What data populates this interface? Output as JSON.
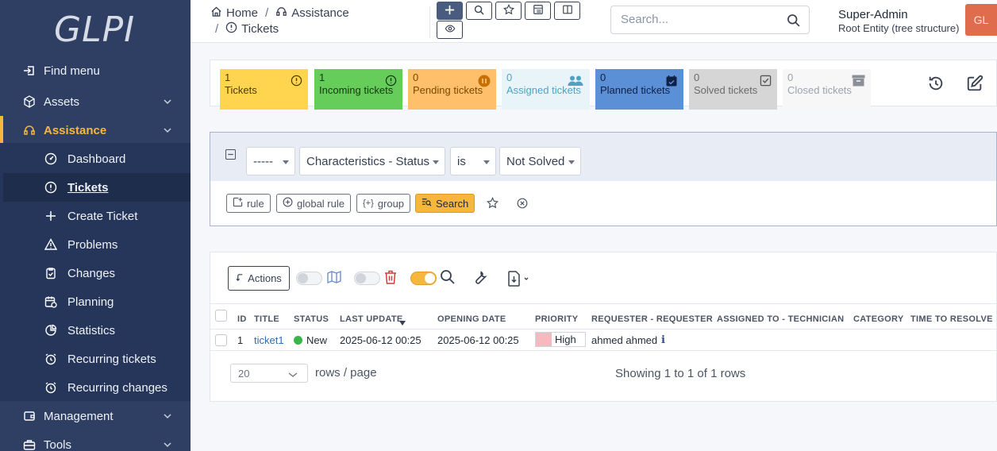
{
  "app": {
    "logo": "GLPI"
  },
  "sidebar": {
    "items": [
      {
        "label": "Find menu",
        "icon": "find-menu-icon"
      },
      {
        "label": "Assets",
        "icon": "cube-icon"
      },
      {
        "label": "Assistance",
        "icon": "headset-icon"
      },
      {
        "label": "Management",
        "icon": "wallet-icon"
      },
      {
        "label": "Tools",
        "icon": "briefcase-icon"
      }
    ],
    "subitems": [
      {
        "label": "Dashboard",
        "icon": "gauge-icon"
      },
      {
        "label": "Tickets",
        "icon": "alert-circle-icon"
      },
      {
        "label": "Create Ticket",
        "icon": "plus-icon"
      },
      {
        "label": "Problems",
        "icon": "alert-triangle-icon"
      },
      {
        "label": "Changes",
        "icon": "clipboard-check-icon"
      },
      {
        "label": "Planning",
        "icon": "calendar-time-icon"
      },
      {
        "label": "Statistics",
        "icon": "chart-pie-icon"
      },
      {
        "label": "Recurring tickets",
        "icon": "alarm-icon"
      },
      {
        "label": "Recurring changes",
        "icon": "alarm-icon"
      }
    ]
  },
  "header": {
    "breadcrumb": {
      "home": "Home",
      "assistance": "Assistance",
      "sep": "/",
      "tickets": "Tickets"
    },
    "search_placeholder": "Search...",
    "user_name": "Super-Admin",
    "user_entity": "Root Entity (tree structure)",
    "avatar_initials": "GL"
  },
  "tiles": [
    {
      "count": "1",
      "label": "Tickets",
      "bg": "#ffd54f",
      "fg": "#4b3b00"
    },
    {
      "count": "1",
      "label": "Incoming tickets",
      "bg": "#66cc5a",
      "fg": "#14380f"
    },
    {
      "count": "0",
      "label": "Pending tickets",
      "bg": "#ffbf6b",
      "fg": "#7a4a00"
    },
    {
      "count": "0",
      "label": "Assigned tickets",
      "bg": "#e9f4f8",
      "fg": "#4da3c7"
    },
    {
      "count": "0",
      "label": "Planned tickets",
      "bg": "#5b8fd6",
      "fg": "#0f2147"
    },
    {
      "count": "0",
      "label": "Solved tickets",
      "bg": "#d6d6d6",
      "fg": "#6b6b6b"
    },
    {
      "count": "0",
      "label": "Closed tickets",
      "bg": "#f7f7f7",
      "fg": "#9ca3af"
    }
  ],
  "criteria": {
    "link": "-----",
    "field": "Characteristics - Status",
    "operator": "is",
    "value": "Not Solved",
    "buttons": {
      "rule": "rule",
      "global_rule": "global rule",
      "group": "group",
      "search": "Search"
    }
  },
  "results": {
    "actions_label": "Actions",
    "columns": [
      "ID",
      "TITLE",
      "STATUS",
      "LAST UPDATE",
      "OPENING DATE",
      "PRIORITY",
      "REQUESTER - REQUESTER",
      "ASSIGNED TO - TECHNICIAN",
      "CATEGORY",
      "TIME TO RESOLVE"
    ],
    "rows": [
      {
        "id": "1",
        "title": "ticket1",
        "status": "New",
        "last_update": "2025-06-12 00:25",
        "opening_date": "2025-06-12 00:25",
        "priority": "High",
        "requester": "ahmed ahmed",
        "assigned": "",
        "category": "",
        "ttr": ""
      }
    ],
    "rows_per_page": "20",
    "rows_per_page_label": "rows / page",
    "showing": "Showing 1 to 1 of 1 rows"
  }
}
